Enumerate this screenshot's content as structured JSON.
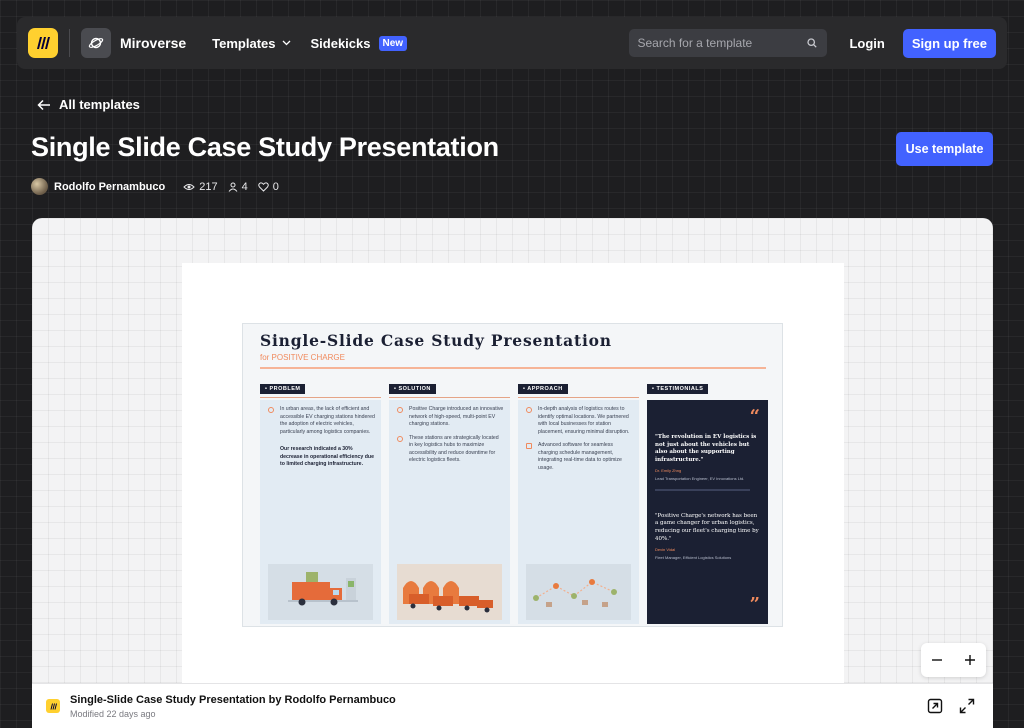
{
  "navbar": {
    "brand": "Miroverse",
    "templates_label": "Templates",
    "sidekicks_label": "Sidekicks",
    "new_badge": "New",
    "search_placeholder": "Search for a template",
    "login_label": "Login",
    "signup_label": "Sign up free"
  },
  "header": {
    "back_label": "All templates",
    "title": "Single Slide Case Study Presentation",
    "use_template_label": "Use template",
    "author": "Rodolfo Pernambuco",
    "views": "217",
    "copies": "4",
    "likes": "0"
  },
  "slide": {
    "title": "Single-Slide Case Study Presentation",
    "subtitle": "for POSITIVE CHARGE",
    "columns": [
      {
        "tag": "• PROBLEM",
        "paragraphs": [
          "In urban areas, the lack of efficient and accessible EV charging stations hindered the adoption of electric vehicles, particularly among logistics companies.",
          "Our research indicated a 30% decrease in operational efficiency due to limited charging infrastructure."
        ]
      },
      {
        "tag": "• SOLUTION",
        "paragraphs": [
          "Positive Charge introduced an innovative network of high-speed, multi-point EV charging stations.",
          "These stations are strategically located in key logistics hubs to maximize accessibility and reduce downtime for electric logistics fleets."
        ]
      },
      {
        "tag": "• APPROACH",
        "paragraphs": [
          "In-depth analysis of logistics routes to identify optimal locations. We partnered with local businesses for station placement, ensuring minimal disruption.",
          "Advanced software for seamless charging schedule management, integrating real-time data to optimize usage."
        ]
      }
    ],
    "testimonials": {
      "tag": "• TESTIMONIALS",
      "quote1": "\"The revolution in EV logistics is not just about the vehicles but also about the supporting infrastructure.\"",
      "name1": "Dr. Emily Zhng",
      "role1": "Lead Transportation Engineer, EV Innovations Ltd.",
      "quote2": "\"Positive Charge's network has been a game changer for urban logistics, reducing our fleet's charging time by 40%.\"",
      "name2": "Devin Vidal",
      "role2": "Fleet Manager, Efficient Logistics Solutions"
    }
  },
  "footer": {
    "title": "Single-Slide Case Study Presentation by Rodolfo Pernambuco",
    "modified": "Modified 22 days ago"
  },
  "colors": {
    "accent": "#4262ff",
    "brand_yellow": "#ffd02f",
    "slide_orange": "#f08a5d",
    "slide_navy": "#1b2033"
  }
}
